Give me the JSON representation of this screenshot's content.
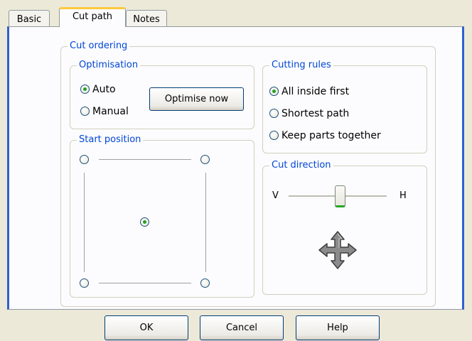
{
  "tabs": [
    {
      "label": "Basic"
    },
    {
      "label": "Cut path"
    },
    {
      "label": "Notes"
    }
  ],
  "active_tab": "Cut path",
  "cut_ordering": {
    "legend": "Cut ordering",
    "optimisation": {
      "legend": "Optimisation",
      "options": [
        {
          "label": "Auto",
          "checked": true
        },
        {
          "label": "Manual",
          "checked": false
        }
      ],
      "optimise_button": "Optimise now"
    },
    "start_position": {
      "legend": "Start position",
      "selected": "center"
    },
    "cutting_rules": {
      "legend": "Cutting rules",
      "options": [
        {
          "label": "All inside first",
          "checked": true
        },
        {
          "label": "Shortest path",
          "checked": false
        },
        {
          "label": "Keep parts together",
          "checked": false
        }
      ]
    },
    "cut_direction": {
      "legend": "Cut direction",
      "left_label": "V",
      "right_label": "H",
      "slider_position": 0.5,
      "icon": "move-arrows-icon"
    }
  },
  "footer": {
    "ok": "OK",
    "cancel": "Cancel",
    "help": "Help"
  },
  "colors": {
    "accent": "#0046d5",
    "tab_highlight": "#ffc83c",
    "radio_dot": "#21a121",
    "slider_thumb": "#2aa52a"
  }
}
